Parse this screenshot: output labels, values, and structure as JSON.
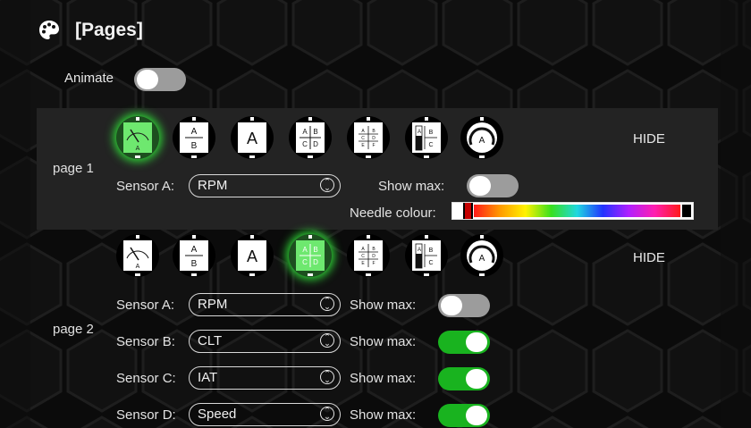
{
  "header": {
    "title": "[Pages]",
    "icon": "palette-icon"
  },
  "animate": {
    "label": "Animate",
    "on": false
  },
  "layout_options": [
    "gauge-dial",
    "two-row-ab",
    "single-a",
    "quad-abcd",
    "six-abcdef",
    "bar-bc",
    "arc-a"
  ],
  "pages": [
    {
      "label": "page 1",
      "selected_layout": 0,
      "hide_label": "HIDE",
      "sensors": [
        {
          "label": "Sensor A:",
          "value": "RPM"
        }
      ],
      "show_max_label": "Show max:",
      "show_max": [
        false
      ],
      "needle_colour_label": "Needle colour:"
    },
    {
      "label": "page 2",
      "selected_layout": 3,
      "hide_label": "HIDE",
      "sensors": [
        {
          "label": "Sensor A:",
          "value": "RPM"
        },
        {
          "label": "Sensor B:",
          "value": "CLT"
        },
        {
          "label": "Sensor C:",
          "value": "IAT"
        },
        {
          "label": "Sensor D:",
          "value": "Speed"
        }
      ],
      "show_max_label": "Show max:",
      "show_max": [
        false,
        true,
        true,
        true
      ]
    }
  ],
  "tile_text": {
    "a": "A",
    "b": "B",
    "c": "C",
    "d": "D",
    "e": "E",
    "f": "F"
  },
  "colors": {
    "accent_on": "#19b31f",
    "selected_glow": "#2fd637",
    "band": "#232323"
  }
}
